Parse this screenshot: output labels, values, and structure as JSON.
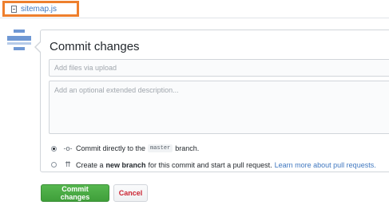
{
  "file_tab": {
    "name": "sitemap.js"
  },
  "commit": {
    "title": "Commit changes",
    "summary_placeholder": "Add files via upload",
    "description_placeholder": "Add an optional extended description...",
    "option_direct": {
      "prefix": "Commit directly to the",
      "branch": "master",
      "suffix": "branch."
    },
    "option_new_branch": {
      "prefix": "Create a",
      "bold": "new branch",
      "suffix": "for this commit and start a pull request.",
      "link": "Learn more about pull requests."
    },
    "commit_button": "Commit changes",
    "cancel_button": "Cancel"
  },
  "colors": {
    "highlight_border": "#ee7f2d",
    "commit_green": "#3f9f3a",
    "link_blue": "#4078c0",
    "cancel_red": "#cb2431",
    "avatar_blue": "#6f98d4"
  },
  "icons": {
    "file": "file-icon",
    "avatar": "avatar-icon",
    "commit": "git-commit-icon",
    "pull_request": "git-pull-request-icon"
  }
}
